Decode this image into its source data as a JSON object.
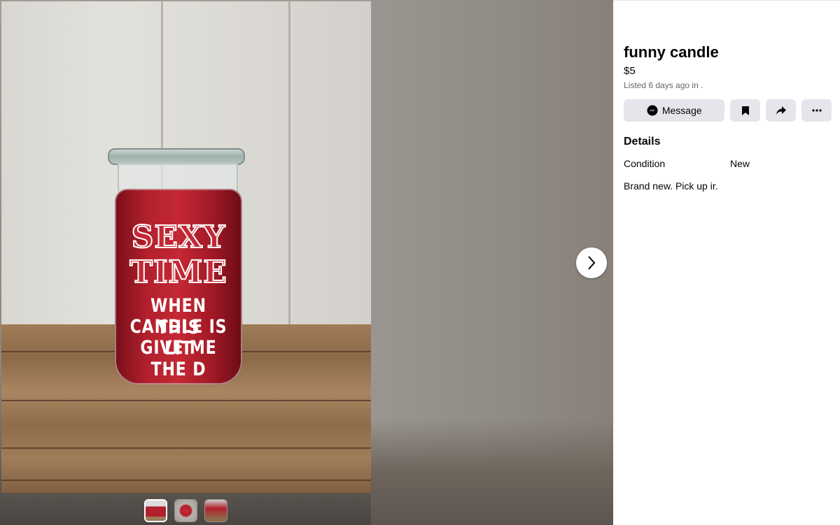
{
  "listing": {
    "title": "funny candle",
    "price": "$5",
    "listed": "Listed 6 days ago in ."
  },
  "actions": {
    "message_label": "Message",
    "save_icon": "bookmark-icon",
    "share_icon": "share-icon",
    "more_icon": "more-icon"
  },
  "details": {
    "heading": "Details",
    "condition_label": "Condition",
    "condition_value": "New",
    "description": "Brand new. Pick up ir."
  },
  "photo": {
    "candle_lines": [
      "SEXY",
      "TIME",
      "WHEN THIS",
      "CANDLE IS LIT",
      "GIVE ME THE D"
    ]
  },
  "thumbnails": [
    {
      "name": "thumbnail-1",
      "active": true
    },
    {
      "name": "thumbnail-2",
      "active": false
    },
    {
      "name": "thumbnail-3",
      "active": false
    }
  ],
  "colors": {
    "button_bg": "#e4e6eb",
    "text_primary": "#050505",
    "text_secondary": "#65676b"
  }
}
